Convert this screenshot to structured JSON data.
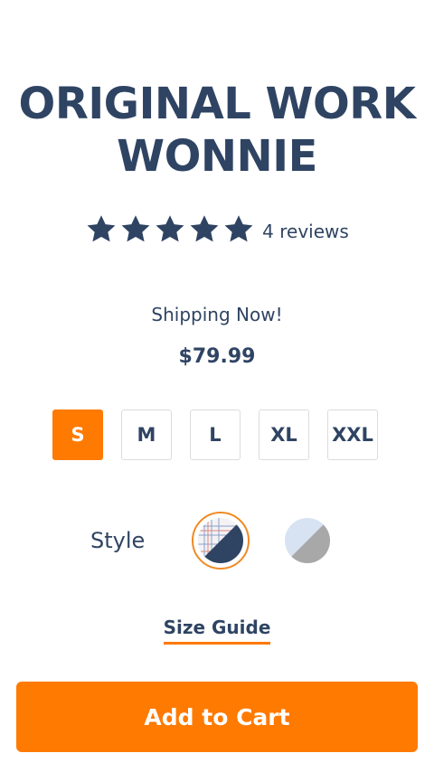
{
  "product": {
    "title_line1": "ORIGINAL WORK",
    "title_line2": "WONNIE",
    "rating": 5,
    "reviews_label": "4 reviews",
    "shipping_status": "Shipping Now!",
    "price": "$79.99"
  },
  "sizes": {
    "options": [
      "S",
      "M",
      "L",
      "XL",
      "XXL"
    ],
    "selected": "S"
  },
  "style": {
    "label": "Style",
    "swatches": [
      {
        "name": "plaid-navy",
        "selected": true,
        "colors": [
          "#ffffff",
          "#2f4463"
        ]
      },
      {
        "name": "lightblue-gray",
        "selected": false,
        "colors": [
          "#d7e3f2",
          "#a8a8a8"
        ]
      }
    ]
  },
  "links": {
    "size_guide": "Size Guide"
  },
  "actions": {
    "add_to_cart": "Add to Cart"
  },
  "colors": {
    "text_primary": "#2f4463",
    "accent": "#ff7a00"
  }
}
